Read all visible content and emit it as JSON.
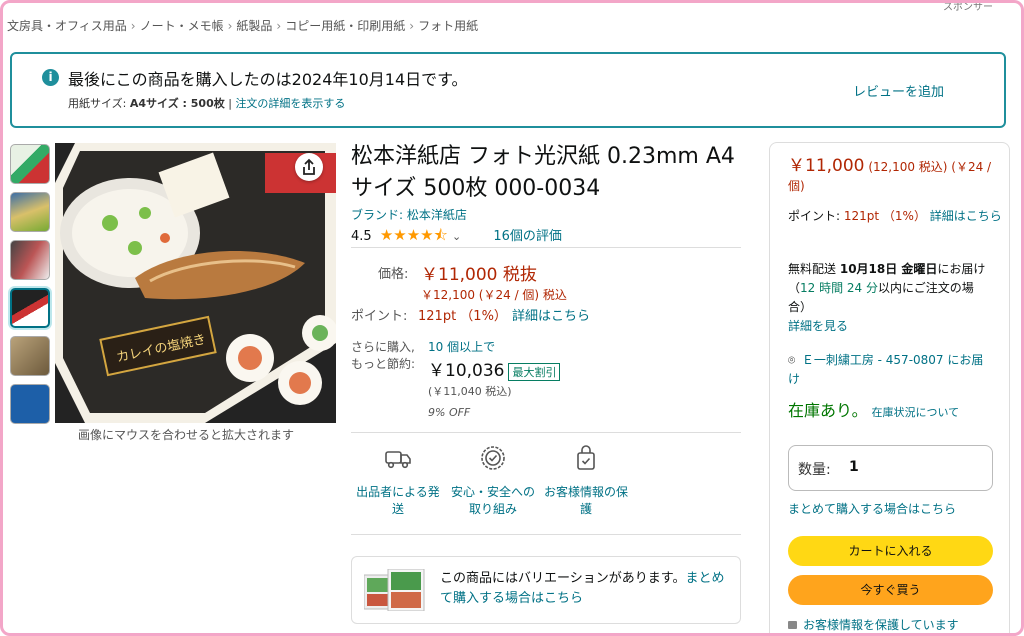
{
  "sponsor": "スポンサー",
  "breadcrumb": [
    "文房具・オフィス用品",
    "ノート・メモ帳",
    "紙製品",
    "コピー用紙・印刷用紙",
    "フォト用紙"
  ],
  "breadcrumb_sep": "›",
  "notice": {
    "title": "最後にこの商品を購入したのは2024年10月14日です。",
    "sub_label": "用紙サイズ: ",
    "sub_value": "A4サイズ : 500枚",
    "sub_sep": " | ",
    "sub_link": "注文の詳細を表示する",
    "review": "レビューを追加"
  },
  "image_hint": "画像にマウスを合わせると拡大されます",
  "product": {
    "title": "松本洋紙店 フォト光沢紙 0.23mm A4サイズ 500枚 000-0034",
    "brand": "ブランド: 松本洋紙店",
    "rating_value": "4.5",
    "rating_count": "16個の評価"
  },
  "price": {
    "label": "価格:",
    "main": "￥11,000 税抜",
    "incl": "￥12,100 (￥24 / 個) 税込",
    "point_label": "ポイント:",
    "point_value": "121pt （1%）",
    "point_link": "詳細はこちら",
    "bulk_label1": "さらに購入,",
    "bulk_link": "10 個以上で",
    "bulk_label2": "もっと節約:",
    "bulk_price": "￥10,036",
    "bulk_badge": "最大割引",
    "bulk_incl": "(￥11,040 税込)",
    "bulk_off": "9% OFF"
  },
  "features": [
    {
      "label": "出品者による発送",
      "icon": "truck-icon"
    },
    {
      "label": "安心・安全への取り組み",
      "icon": "shield-badge-icon"
    },
    {
      "label": "お客様情報の保護",
      "icon": "secure-bag-icon"
    }
  ],
  "variation": {
    "text": "この商品にはバリエーションがあります。",
    "link": "まとめて購入する場合はこちら"
  },
  "buybox": {
    "price": "￥11,000",
    "price_incl": "(12,100 税込) (￥24 / 個)",
    "point_label": "ポイント: ",
    "point_value": "121pt （1%）",
    "point_link": "詳細はこちら",
    "delivery1": "無料配送",
    "delivery_date": "10月18日 金曜日",
    "delivery2": "にお届け（",
    "delivery_time": "12 時間 24 分",
    "delivery3": "以内にご注文の場合）",
    "delivery_link": "詳細を見る",
    "address": "Ｅ一刺繍工房 - 457-0807 にお届け",
    "stock": "在庫あり。",
    "stock_link": "在庫状況について",
    "qty_label": "数量:",
    "qty_value": "1",
    "bulk_link": "まとめて購入する場合はこちら",
    "cart": "カートに入れる",
    "buy": "今すぐ買う",
    "secure": "お客様情報を保護しています"
  },
  "colors": {
    "accent": "#007185",
    "price": "#b12704",
    "cart": "#ffd814",
    "buy": "#ffa41c",
    "notice_border": "#1f8f9c",
    "frame": "#f3a6c8"
  }
}
